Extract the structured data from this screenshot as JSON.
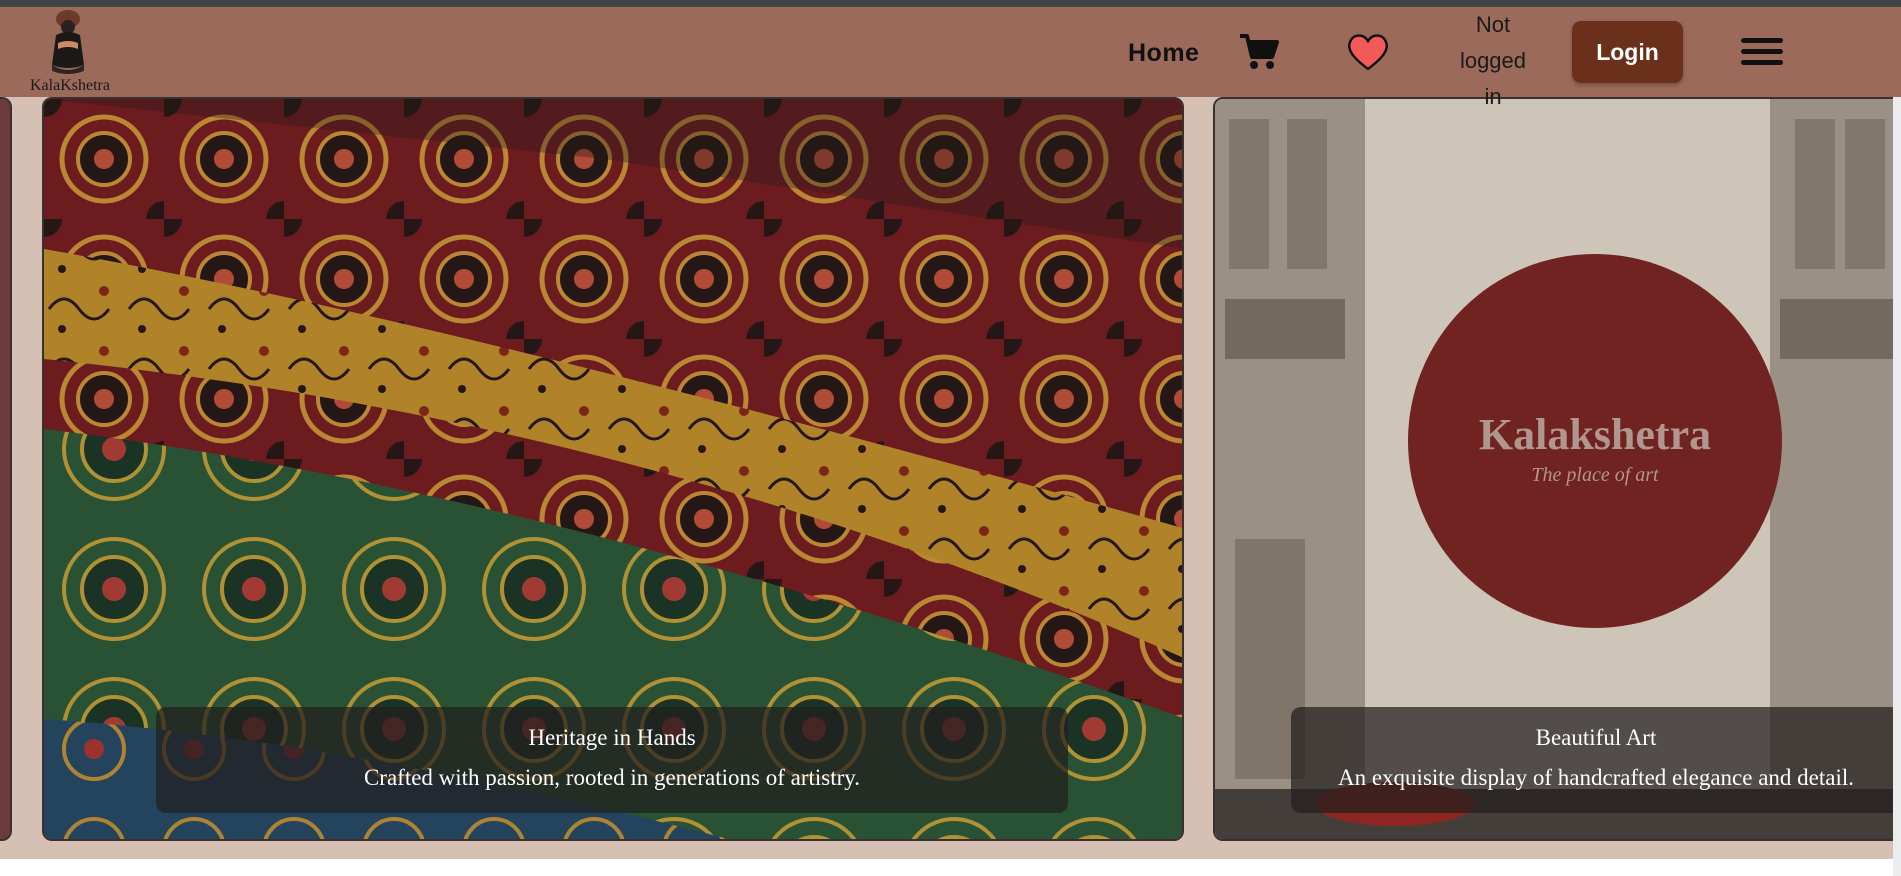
{
  "brand": {
    "name": "KalaKshetra"
  },
  "nav": {
    "home_label": "Home",
    "cart_icon": "shopping-cart-icon",
    "wishlist_icon": "heart-icon",
    "status_lines": [
      "Not",
      "logged",
      "in"
    ],
    "login_label": "Login",
    "menu_icon": "hamburger-menu-icon"
  },
  "slides": [
    {
      "title": "Heritage in Hands",
      "text": "Crafted with passion, rooted in generations of artistry."
    },
    {
      "title": "Beautiful Art",
      "text": "An exquisite display of handcrafted elegance and detail.",
      "sign_title": "Kalakshetra",
      "sign_subtitle": "The place of art"
    }
  ],
  "colors": {
    "navbar": "#9b6a5a",
    "login": "#6b301c",
    "heart": "#f25a5a",
    "background": "#d6bfb3"
  }
}
